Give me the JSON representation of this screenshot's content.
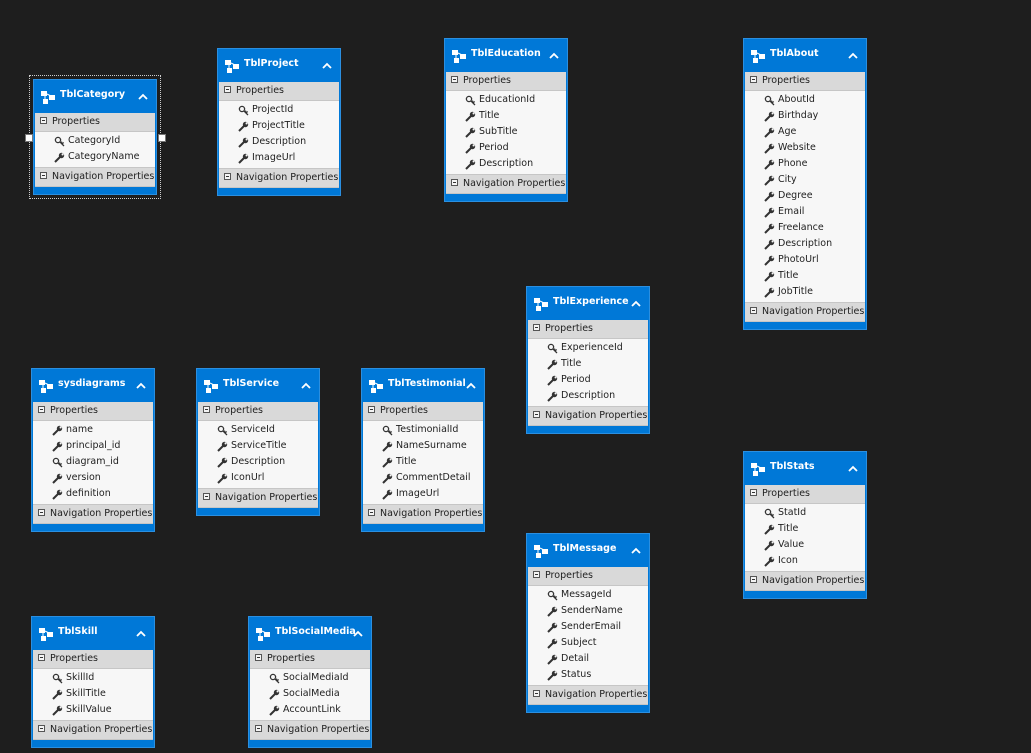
{
  "diagram": {
    "section_properties": "Properties",
    "section_navigation": "Navigation Properties",
    "selected_entity": "TblCategory",
    "entities": [
      {
        "name": "TblCategory",
        "properties": [
          {
            "name": "CategoryId",
            "key": true
          },
          {
            "name": "CategoryName",
            "key": false
          }
        ]
      },
      {
        "name": "TblProject",
        "properties": [
          {
            "name": "ProjectId",
            "key": true
          },
          {
            "name": "ProjectTitle",
            "key": false
          },
          {
            "name": "Description",
            "key": false
          },
          {
            "name": "ImageUrl",
            "key": false
          }
        ]
      },
      {
        "name": "TblEducation",
        "properties": [
          {
            "name": "EducationId",
            "key": true
          },
          {
            "name": "Title",
            "key": false
          },
          {
            "name": "SubTitle",
            "key": false
          },
          {
            "name": "Period",
            "key": false
          },
          {
            "name": "Description",
            "key": false
          }
        ]
      },
      {
        "name": "TblAbout",
        "properties": [
          {
            "name": "AboutId",
            "key": true
          },
          {
            "name": "Birthday",
            "key": false
          },
          {
            "name": "Age",
            "key": false
          },
          {
            "name": "Website",
            "key": false
          },
          {
            "name": "Phone",
            "key": false
          },
          {
            "name": "City",
            "key": false
          },
          {
            "name": "Degree",
            "key": false
          },
          {
            "name": "Email",
            "key": false
          },
          {
            "name": "Freelance",
            "key": false
          },
          {
            "name": "Description",
            "key": false
          },
          {
            "name": "PhotoUrl",
            "key": false
          },
          {
            "name": "Title",
            "key": false
          },
          {
            "name": "JobTitle",
            "key": false
          }
        ]
      },
      {
        "name": "TblExperience",
        "properties": [
          {
            "name": "ExperienceId",
            "key": true
          },
          {
            "name": "Title",
            "key": false
          },
          {
            "name": "Period",
            "key": false
          },
          {
            "name": "Description",
            "key": false
          }
        ]
      },
      {
        "name": "sysdiagrams",
        "properties": [
          {
            "name": "name",
            "key": false
          },
          {
            "name": "principal_id",
            "key": false
          },
          {
            "name": "diagram_id",
            "key": true
          },
          {
            "name": "version",
            "key": false
          },
          {
            "name": "definition",
            "key": false
          }
        ]
      },
      {
        "name": "TblService",
        "properties": [
          {
            "name": "ServiceId",
            "key": true
          },
          {
            "name": "ServiceTitle",
            "key": false
          },
          {
            "name": "Description",
            "key": false
          },
          {
            "name": "IconUrl",
            "key": false
          }
        ]
      },
      {
        "name": "TblTestimonial",
        "properties": [
          {
            "name": "TestimonialId",
            "key": true
          },
          {
            "name": "NameSurname",
            "key": false
          },
          {
            "name": "Title",
            "key": false
          },
          {
            "name": "CommentDetail",
            "key": false
          },
          {
            "name": "ImageUrl",
            "key": false
          }
        ]
      },
      {
        "name": "TblStats",
        "properties": [
          {
            "name": "StatId",
            "key": true
          },
          {
            "name": "Title",
            "key": false
          },
          {
            "name": "Value",
            "key": false
          },
          {
            "name": "Icon",
            "key": false
          }
        ]
      },
      {
        "name": "TblMessage",
        "properties": [
          {
            "name": "MessageId",
            "key": true
          },
          {
            "name": "SenderName",
            "key": false
          },
          {
            "name": "SenderEmail",
            "key": false
          },
          {
            "name": "Subject",
            "key": false
          },
          {
            "name": "Detail",
            "key": false
          },
          {
            "name": "Status",
            "key": false
          }
        ]
      },
      {
        "name": "TblSkill",
        "properties": [
          {
            "name": "SkillId",
            "key": true
          },
          {
            "name": "SkillTitle",
            "key": false
          },
          {
            "name": "SkillValue",
            "key": false
          }
        ]
      },
      {
        "name": "TblSocialMedia",
        "properties": [
          {
            "name": "SocialMediaId",
            "key": true
          },
          {
            "name": "SocialMedia",
            "key": false
          },
          {
            "name": "AccountLink",
            "key": false
          }
        ]
      }
    ],
    "icons": {
      "entity": "entity-type-icon",
      "collapse": "chevron-up-icon",
      "key_property": "key-icon",
      "property": "wrench-icon",
      "section_toggle": "collapse-toggle-icon"
    }
  }
}
